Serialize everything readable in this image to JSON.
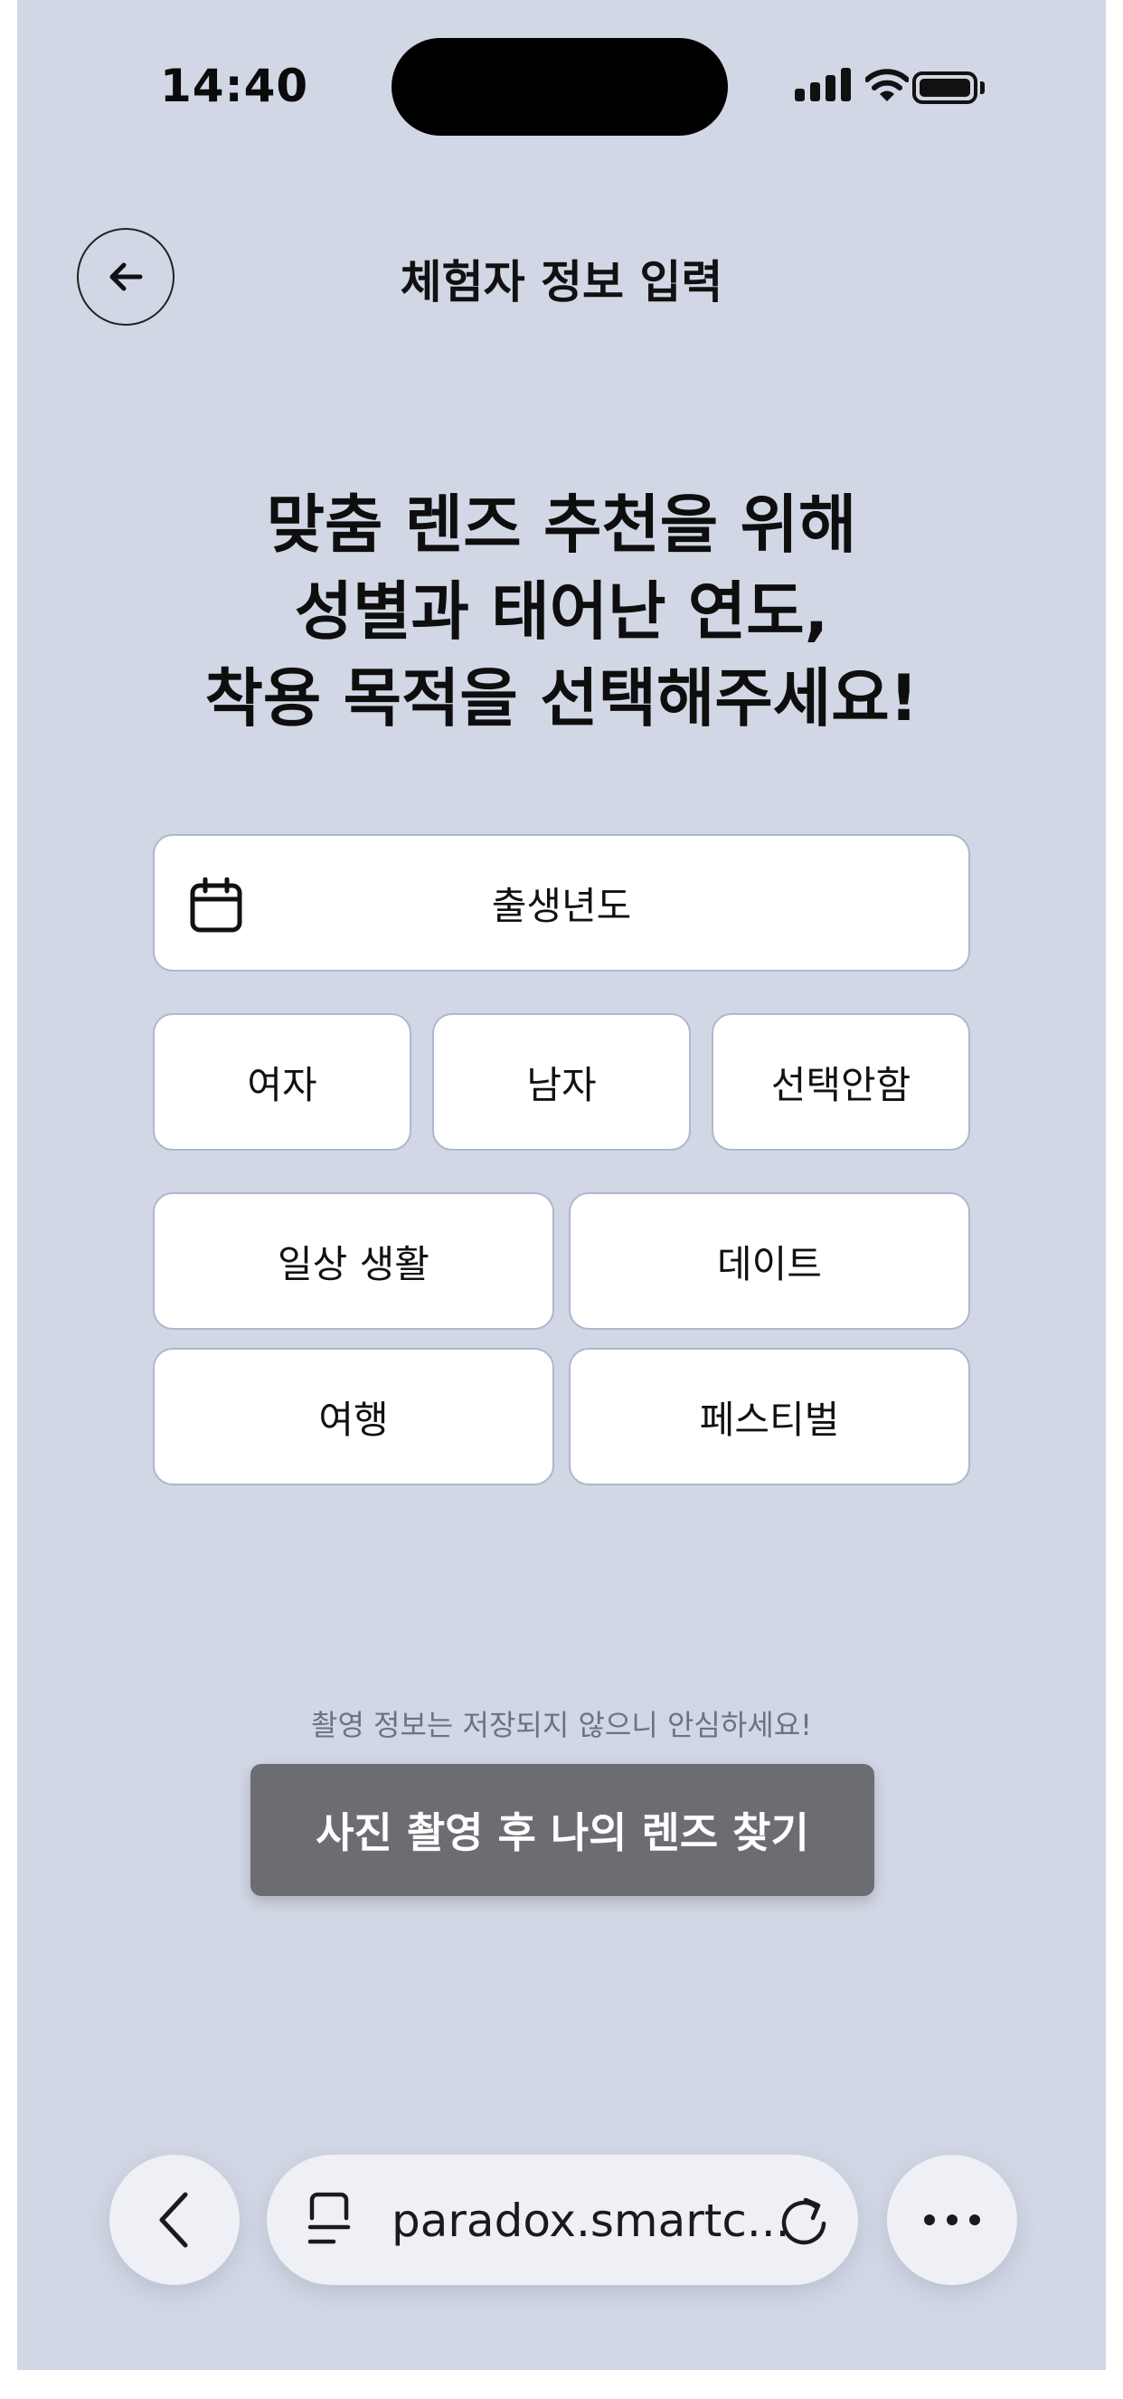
{
  "status_bar": {
    "time": "14:40"
  },
  "header": {
    "title": "체험자 정보 입력"
  },
  "headline": {
    "lines": [
      "맞춤 렌즈 추천을 위해",
      "성별과 태어난 연도,",
      "착용 목적을 선택해주세요!"
    ]
  },
  "form": {
    "birth_year_label": "출생년도",
    "gender_options": [
      "여자",
      "남자",
      "선택안함"
    ],
    "purpose_options": [
      "일상 생활",
      "데이트",
      "여행",
      "페스티벌"
    ]
  },
  "footer": {
    "privacy_note": "촬영 정보는 저장되지 않으니 안심하세요!",
    "cta_label": "사진 촬영 후 나의 렌즈 찾기"
  },
  "browser": {
    "url": "paradox.smartc..."
  },
  "colors": {
    "background": "#d1d7e4",
    "card": "#ffffff",
    "card_border": "#aeb8cc",
    "cta": "#6b6d72"
  }
}
